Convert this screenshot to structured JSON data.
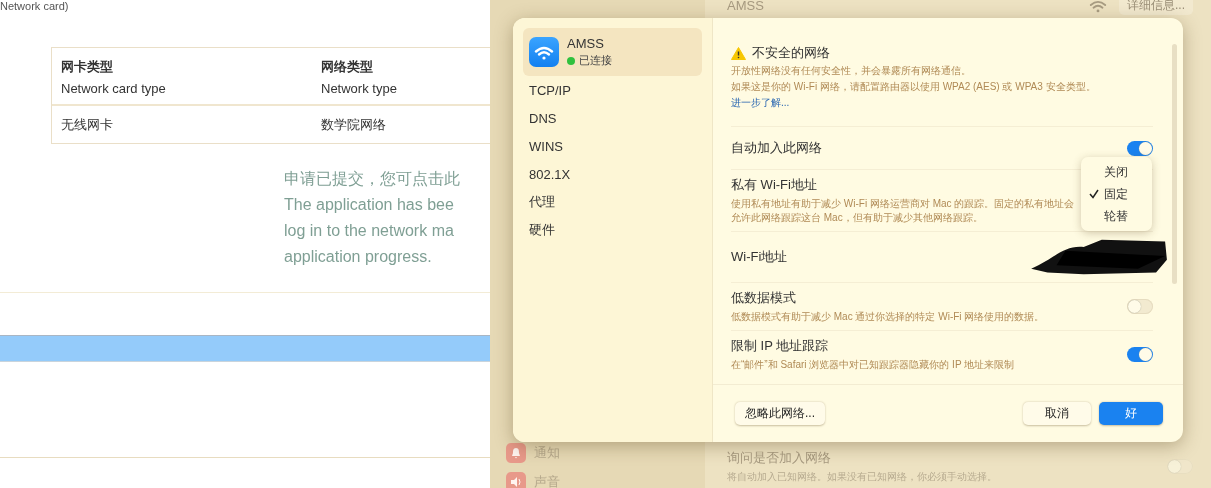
{
  "web_page": {
    "top_text": "Network card)",
    "table": {
      "columns": [
        {
          "zh": "网卡类型",
          "en": "Network card type"
        },
        {
          "zh": "网络类型",
          "en": "Network type"
        }
      ],
      "rows": [
        [
          "无线网卡",
          "数学院网络"
        ]
      ]
    },
    "message": [
      "申请已提交，您可点击此",
      "The application has bee",
      "log in to the network ma",
      "application progress."
    ]
  },
  "background_window": {
    "network_name": "AMSS",
    "details_button": "详细信息...",
    "sidebar_items": [
      {
        "label": "通知",
        "kind": "bell"
      },
      {
        "label": "声音",
        "kind": "speaker"
      }
    ],
    "ask_to_join": {
      "title": "询问是否加入网络",
      "description": "将自动加入已知网络。如果没有已知网络，你必须手动选择。",
      "on": false
    }
  },
  "dialog": {
    "network": {
      "name": "AMSS",
      "status": "已连接",
      "connected": true,
      "selected": true
    },
    "tabs": [
      {
        "label": "TCP/IP",
        "selected": false
      },
      {
        "label": "DNS",
        "selected": false
      },
      {
        "label": "WINS",
        "selected": false
      },
      {
        "label": "802.1X",
        "selected": false
      },
      {
        "label": "代理",
        "selected": false
      },
      {
        "label": "硬件",
        "selected": false
      }
    ],
    "warning": {
      "title": "不安全的网络",
      "lines": [
        "开放性网络没有任何安全性，并会暴露所有网络通信。",
        "如果这是你的 Wi-Fi 网络，请配置路由器以使用 WPA2 (AES) 或 WPA3 安全类型。"
      ],
      "link": "进一步了解..."
    },
    "rows": [
      {
        "kind": "toggle",
        "title": "自动加入此网络",
        "on": true
      },
      {
        "kind": "menu",
        "title": "私有 Wi-Fi地址",
        "description": "使用私有地址有助于减少 Wi-Fi 网络运营商对 Mac 的跟踪。固定的私有地址会允许此网络跟踪这台 Mac，但有助于减少其他网络跟踪。"
      },
      {
        "kind": "value",
        "title": "Wi-Fi地址",
        "redacted": true
      },
      {
        "kind": "toggle",
        "title": "低数据模式",
        "description": "低数据模式有助于减少 Mac 通过你选择的特定 Wi-Fi 网络使用的数据。",
        "on": false
      },
      {
        "kind": "toggle",
        "title": "限制 IP 地址跟踪",
        "description": "在“邮件”和 Safari 浏览器中对已知跟踪器隐藏你的 IP 地址来限制",
        "on": true
      }
    ],
    "menu": {
      "options": [
        {
          "label": "关闭",
          "selected": false
        },
        {
          "label": "固定",
          "selected": true
        },
        {
          "label": "轮替",
          "selected": false
        }
      ]
    },
    "buttons": {
      "ignore": "忽略此网络...",
      "cancel": "取消",
      "ok": "好"
    }
  }
}
